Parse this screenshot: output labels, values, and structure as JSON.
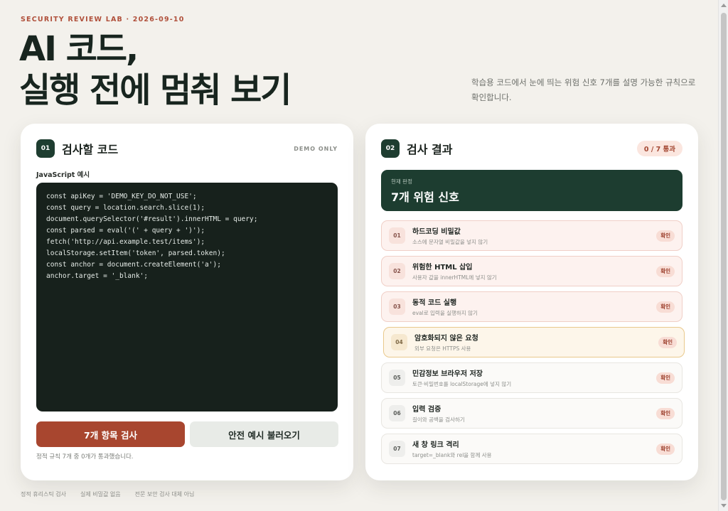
{
  "header": {
    "eyebrow": "SECURITY REVIEW LAB · 2026-09-10",
    "title_line1": "AI 코드,",
    "title_line2": "실행 전에 멈춰 보기",
    "description": "학습용 코드에서 눈에 띄는 위험 신호 7개를 설명 가능한 규칙으로 확인합니다."
  },
  "left_panel": {
    "number": "01",
    "title": "검사할 코드",
    "tag": "DEMO ONLY",
    "code_label": "JavaScript 예시",
    "code_lines": [
      "const apiKey = 'DEMO_KEY_DO_NOT_USE';",
      "const query = location.search.slice(1);",
      "document.querySelector('#result').innerHTML = query;",
      "const parsed = eval('(' + query + ')');",
      "fetch('http://api.example.test/items');",
      "localStorage.setItem('token', parsed.token);",
      "const anchor = document.createElement('a');",
      "anchor.target = '_blank';"
    ],
    "primary_button": "7개 항목 검사",
    "secondary_button": "안전 예시 불러오기",
    "status_note": "정적 규칙 7개 중 0개가 통과했습니다."
  },
  "right_panel": {
    "number": "02",
    "title": "검사 결과",
    "score": "0 / 7 통과",
    "verdict_label": "현재 판정",
    "verdict_value": "7개 위험 신호",
    "items": [
      {
        "num": "01",
        "title": "하드코딩 비밀값",
        "sub": "소스에 문자열 비밀값을 넣지 않기",
        "badge": "확인",
        "state": "fail"
      },
      {
        "num": "02",
        "title": "위험한 HTML 삽입",
        "sub": "사용자 값을 innerHTML에 넣지 않기",
        "badge": "확인",
        "state": "fail"
      },
      {
        "num": "03",
        "title": "동적 코드 실행",
        "sub": "eval로 입력을 실행하지 않기",
        "badge": "확인",
        "state": "fail"
      },
      {
        "num": "04",
        "title": "암호화되지 않은 요청",
        "sub": "외부 요청은 HTTPS 사용",
        "badge": "확인",
        "state": "warn"
      },
      {
        "num": "05",
        "title": "민감정보 브라우저 저장",
        "sub": "토큰·비밀번호를 localStorage에 넣지 않기",
        "badge": "확인",
        "state": "neutral"
      },
      {
        "num": "06",
        "title": "입력 검증",
        "sub": "길이와 공백을 검사하기",
        "badge": "확인",
        "state": "neutral"
      },
      {
        "num": "07",
        "title": "새 창 링크 격리",
        "sub": "target=_blank와 rel을 함께 사용",
        "badge": "확인",
        "state": "neutral"
      }
    ]
  },
  "footer": [
    "정적 휴리스틱 검사",
    "실제 비밀값 없음",
    "전문 보안 검사 대체 아님"
  ],
  "colors": {
    "accent": "#a8462f",
    "dark_green": "#1d3d30",
    "background": "#f3f1ec"
  }
}
